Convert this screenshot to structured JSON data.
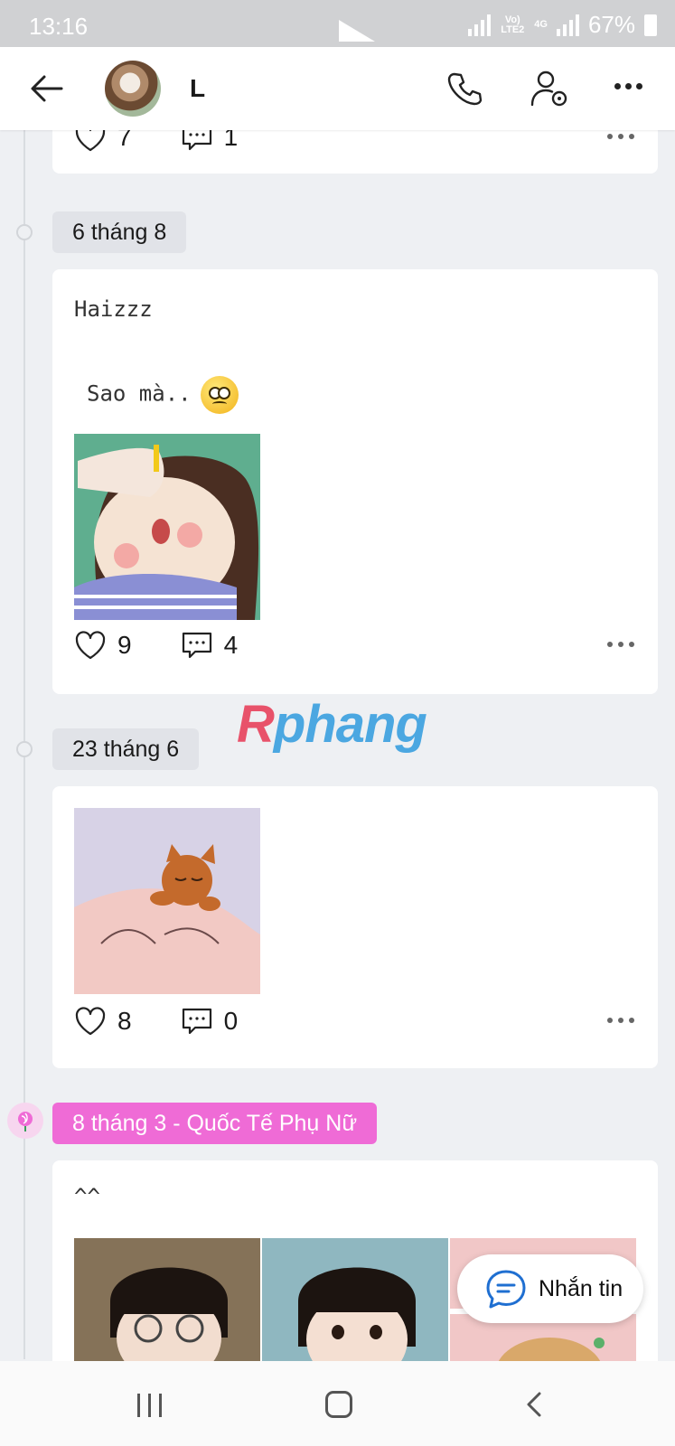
{
  "status_bar": {
    "time": "13:16",
    "network_label": "Vo) LTE2",
    "net_type": "4G",
    "battery": "67%"
  },
  "header": {
    "contact_name": "L"
  },
  "posts": [
    {
      "partial": true,
      "likes": "7",
      "comments": "1"
    },
    {
      "date": "6 tháng 8",
      "lines": [
        "Haizzz",
        "Sao mà.."
      ],
      "likes": "9",
      "comments": "4"
    },
    {
      "date": "23 tháng 6",
      "likes": "8",
      "comments": "0"
    },
    {
      "date": "8 tháng 3 - Quốc Tế Phụ Nữ",
      "lines": [
        "^^"
      ]
    }
  ],
  "watermark": {
    "first": "R",
    "rest": "phang"
  },
  "floating_button": {
    "label": "Nhắn tin"
  },
  "colors": {
    "pink_tag": "#ef6bd6",
    "card_bg": "#ffffff",
    "page_bg": "#eef0f3"
  }
}
